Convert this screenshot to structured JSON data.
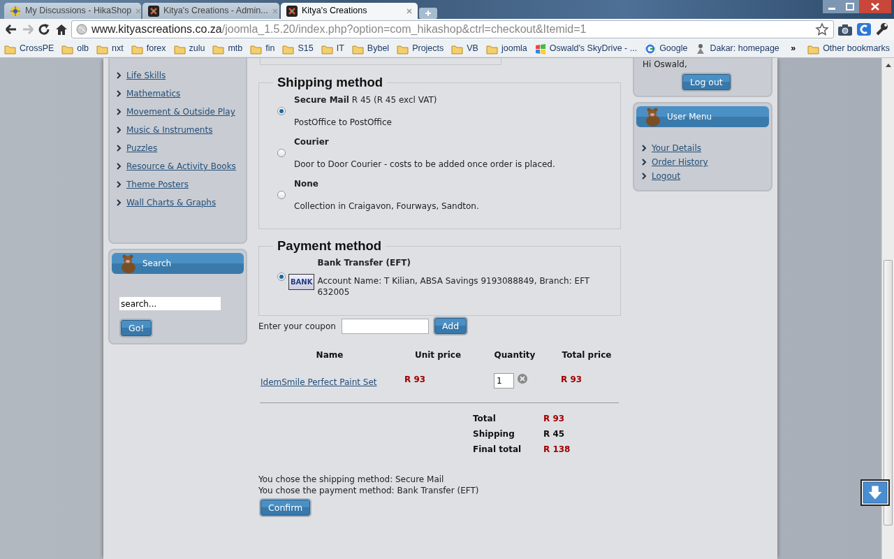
{
  "browser": {
    "tabs": [
      {
        "title": "My Discussions - HikaShop",
        "kind": "star",
        "selected": false
      },
      {
        "title": "Kitya's Creations - Admin...",
        "kind": "joomla",
        "selected": false
      },
      {
        "title": "Kitya's Creations",
        "kind": "joomla",
        "selected": true
      }
    ],
    "address": {
      "host": "www.kityascreations.co.za",
      "path": "/joomla_1.5.20/index.php?option=com_hikashop&ctrl=checkout&Itemid=1"
    },
    "bookmarks": [
      {
        "label": "CrossPE",
        "kind": "folder"
      },
      {
        "label": "olb",
        "kind": "folder"
      },
      {
        "label": "nxt",
        "kind": "folder"
      },
      {
        "label": "forex",
        "kind": "folder"
      },
      {
        "label": "zulu",
        "kind": "folder"
      },
      {
        "label": "mtb",
        "kind": "folder"
      },
      {
        "label": "fin",
        "kind": "folder"
      },
      {
        "label": "S15",
        "kind": "folder"
      },
      {
        "label": "IT",
        "kind": "folder"
      },
      {
        "label": "Bybel",
        "kind": "folder"
      },
      {
        "label": "Projects",
        "kind": "folder"
      },
      {
        "label": "VB",
        "kind": "folder"
      },
      {
        "label": "joomla",
        "kind": "folder"
      },
      {
        "label": "Oswald's SkyDrive - ...",
        "kind": "windows"
      },
      {
        "label": "Google",
        "kind": "google"
      },
      {
        "label": "Dakar: homepage",
        "kind": "dakar"
      }
    ],
    "overflow": "»",
    "other_bookmarks": "Other bookmarks"
  },
  "categories": [
    "Life Skills",
    "Mathematics",
    "Movement & Outside Play",
    "Music & Instruments",
    "Puzzles",
    "Resource & Activity Books",
    "Theme Posters",
    "Wall Charts & Graphs"
  ],
  "search": {
    "title": "Search",
    "value": "search...",
    "button": "Go!"
  },
  "shipping": {
    "title": "Shipping method",
    "options": [
      {
        "name": "Secure Mail",
        "price": "R 45 (R 45 excl VAT)",
        "description": "PostOffice to PostOffice",
        "selected": true
      },
      {
        "name": "Courier",
        "description": "Door to Door Courier - costs to be added once order is placed.",
        "selected": false
      },
      {
        "name": "None",
        "description": "Collection in Craigavon, Fourways, Sandton.",
        "selected": false
      }
    ]
  },
  "payment": {
    "title": "Payment method",
    "options": [
      {
        "name": "Bank Transfer (EFT)",
        "badge": "BANK",
        "description": "Account Name: T Kilian, ABSA Savings 9193088849, Branch: EFT 632005",
        "selected": true
      }
    ]
  },
  "coupon": {
    "label": "Enter your coupon",
    "button": "Add"
  },
  "cart": {
    "columns": [
      "Name",
      "Unit price",
      "Quantity",
      "Total price"
    ],
    "rows": [
      {
        "name": "IdemSmile Perfect Paint Set",
        "unit_price": "R 93",
        "quantity": "1",
        "total_price": "R 93"
      }
    ],
    "totals": [
      {
        "label": "Total",
        "value": "R 93",
        "highlight": true
      },
      {
        "label": "Shipping",
        "value": "R 45",
        "highlight": false
      },
      {
        "label": "Final total",
        "value": "R 138",
        "highlight": true
      }
    ]
  },
  "summary": [
    "You chose the shipping method: Secure Mail",
    "You chose the payment method: Bank Transfer (EFT)"
  ],
  "confirm_button": "Confirm",
  "account": {
    "greeting": "Hi Oswald,",
    "logout_button": "Log out"
  },
  "user_menu": {
    "title": "User Menu",
    "items": [
      "Your Details",
      "Order History",
      "Logout"
    ]
  }
}
